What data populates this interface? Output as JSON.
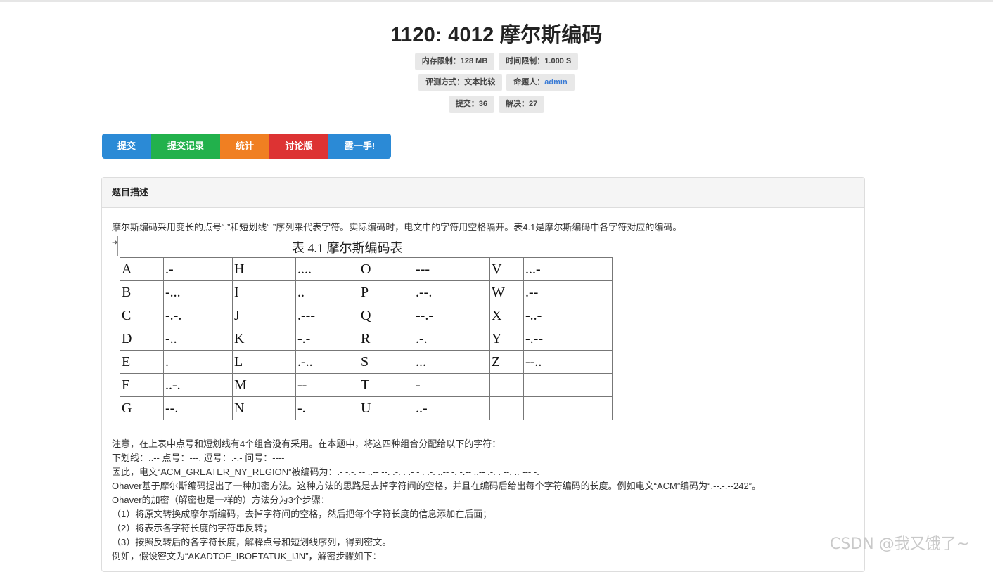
{
  "problem": {
    "title": "1120: 4012 摩尔斯编码",
    "badges_row1": [
      "内存限制：128 MB",
      "时间限制：1.000 S"
    ],
    "judge_label": "评测方式：文本比较",
    "author_label": "命题人：",
    "author": "admin",
    "submit_count": "提交：36",
    "solved_count": "解决：27"
  },
  "buttons": [
    {
      "label": "提交",
      "color": "#2b8ad6"
    },
    {
      "label": "提交记录",
      "color": "#22b14c"
    },
    {
      "label": "统计",
      "color": "#f07f22"
    },
    {
      "label": "讨论版",
      "color": "#dd3333"
    },
    {
      "label": "露一手!",
      "color": "#2b8ad6"
    }
  ],
  "panel": {
    "heading": "题目描述",
    "intro": "摩尔斯编码采用变长的点号“.”和短划线“-”序列来代表字符。实际编码时，电文中的字符用空格隔开。表4.1是摩尔斯编码中各字符对应的编码。",
    "table_title": "表 4.1  摩尔斯编码表",
    "table_rows": [
      [
        "A",
        ".-",
        "H",
        "....",
        "O",
        "---",
        "V",
        "...-"
      ],
      [
        "B",
        "-...",
        "I",
        "..",
        "P",
        ".--.",
        "W",
        ".--"
      ],
      [
        "C",
        "-.-.",
        "J",
        ".---",
        "Q",
        "--.-",
        "X",
        "-..-"
      ],
      [
        "D",
        "-..",
        "K",
        "-.-",
        "R",
        ".-.",
        "Y",
        "-.--"
      ],
      [
        "E",
        ".",
        "L",
        ".-..",
        "S",
        "...",
        "Z",
        "--.."
      ],
      [
        "F",
        "..-.",
        "M",
        "--",
        "T",
        "-",
        "",
        ""
      ],
      [
        "G",
        "--.",
        "N",
        "-.",
        "U",
        "..-",
        "",
        ""
      ]
    ],
    "lines": [
      "注意，在上表中点号和短划线有4个组合没有采用。在本题中，将这四种组合分配给以下的字符：",
      "下划线：..-- 点号：---. 逗号：.-.- 问号：----",
      "因此，电文“ACM_GREATER_NY_REGION”被编码为：.- -.-. -- ..-- --. .-. . .- - . .-. ..-- -. -.-- ..-- .-. . --. .. --- -.",
      "Ohaver基于摩尔斯编码提出了一种加密方法。这种方法的思路是去掉字符间的空格，并且在编码后给出每个字符编码的长度。例如电文“ACM”编码为“.--.-.--242”。",
      "Ohaver的加密（解密也是一样的）方法分为3个步骤：",
      "（1）将原文转换成摩尔斯编码，去掉字符间的空格，然后把每个字符长度的信息添加在后面；",
      "（2）将表示各字符长度的字符串反转；",
      "（3）按照反转后的各字符长度，解释点号和短划线序列，得到密文。",
      "例如，假设密文为“AKADTOF_IBOETATUK_IJN”，解密步骤如下："
    ]
  },
  "watermark": "CSDN @我又饿了~"
}
